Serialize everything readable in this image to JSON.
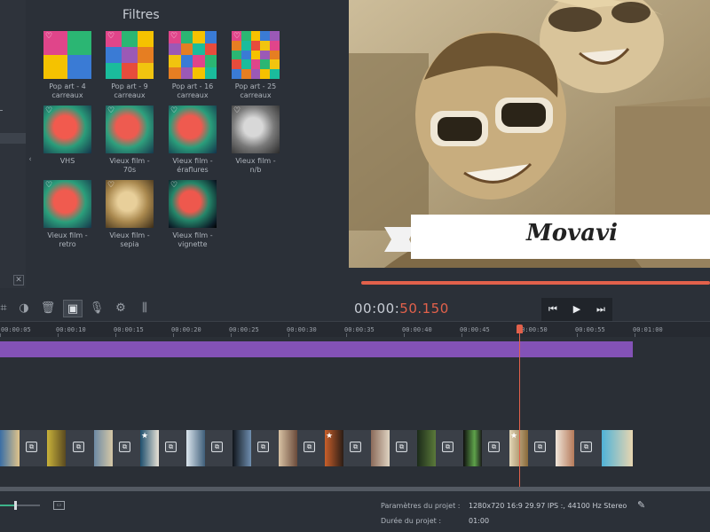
{
  "filters_panel": {
    "title": "Filtres",
    "items": [
      {
        "label_1": "Pop art - 4",
        "label_2": "carreaux",
        "style": "pop4"
      },
      {
        "label_1": "Pop art - 9",
        "label_2": "carreaux",
        "style": "pop9"
      },
      {
        "label_1": "Pop art - 16",
        "label_2": "carreaux",
        "style": "pop16"
      },
      {
        "label_1": "Pop art - 25",
        "label_2": "carreaux",
        "style": "pop25"
      },
      {
        "label_1": "VHS",
        "label_2": "",
        "style": "color"
      },
      {
        "label_1": "Vieux film -",
        "label_2": "70s",
        "style": "color"
      },
      {
        "label_1": "Vieux film -",
        "label_2": "éraflures",
        "style": "color"
      },
      {
        "label_1": "Vieux film -",
        "label_2": "n/b",
        "style": "bw"
      },
      {
        "label_1": "Vieux film -",
        "label_2": "retro",
        "style": "color"
      },
      {
        "label_1": "Vieux film -",
        "label_2": "sepia",
        "style": "sepia"
      },
      {
        "label_1": "Vieux film -",
        "label_2": "vignette",
        "style": "vignette"
      }
    ]
  },
  "preview": {
    "title_text": "Movavi",
    "progress_fraction": 1.0
  },
  "toolbar": {
    "icons": [
      "crop-icon",
      "color-adjust-icon",
      "delete-icon",
      "image-icon",
      "microphone-icon",
      "settings-icon",
      "equalizer-icon"
    ]
  },
  "player": {
    "timecode_prefix": "00:00:",
    "timecode_value": "50.150"
  },
  "timeline": {
    "ruler_labels": [
      "00:00:05",
      "00:00:10",
      "00:00:15",
      "00:00:20",
      "00:00:25",
      "00:00:30",
      "00:00:35",
      "00:00:40",
      "00:00:45",
      "00:00:50",
      "00:00:55",
      "00:01:00"
    ],
    "playhead_time": "00:00:50.150"
  },
  "status": {
    "params_label": "Paramètres du projet :",
    "params_value": "1280x720 16:9 29.97 IPS :, 44100 Hz Stereo",
    "duration_label": "Durée du projet :",
    "duration_value": "01:00"
  },
  "colors": {
    "accent": "#e2614b",
    "audio_clip": "#8352b6",
    "background": "#2b3038"
  }
}
